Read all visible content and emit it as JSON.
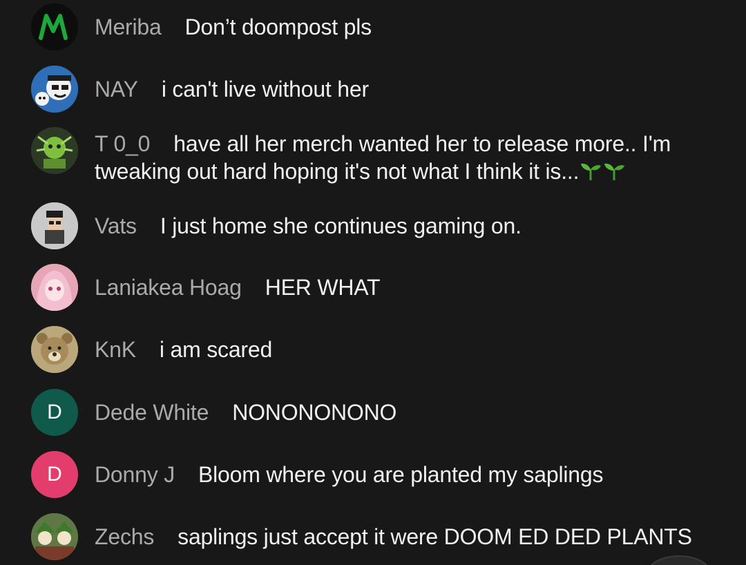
{
  "messages": [
    {
      "author": "Meriba",
      "text": "Don’t doompost pls",
      "avatar": {
        "kind": "image",
        "icon": "green-m-logo",
        "bg": "#0d0d0d",
        "accent": "#1fa83a"
      }
    },
    {
      "author": "NAY",
      "text": "i can't live without her",
      "avatar": {
        "kind": "image",
        "icon": "cartoon-face",
        "bg": "#2f6fb7"
      }
    },
    {
      "author": "T 0_0",
      "text": "have all her merch wanted her to release more.. I'm tweaking out hard hoping it's not what I think it is...",
      "avatar": {
        "kind": "image",
        "icon": "green-creature",
        "bg": "#2c3a25"
      },
      "emoji": [
        "sprout",
        "sprout"
      ]
    },
    {
      "author": "Vats",
      "text": "I just home she continues gaming on.",
      "avatar": {
        "kind": "image",
        "icon": "pixel-character",
        "bg": "#c9c9c9"
      }
    },
    {
      "author": "Laniakea Hoag",
      "text": "HER WHAT",
      "avatar": {
        "kind": "image",
        "icon": "anime-girl-pink",
        "bg": "#e7a6b6"
      }
    },
    {
      "author": "KnK",
      "text": "i am scared",
      "avatar": {
        "kind": "image",
        "icon": "bear-face",
        "bg": "#bba77c"
      }
    },
    {
      "author": "Dede White",
      "text": "NONONONONO",
      "avatar": {
        "kind": "letter",
        "letter": "D",
        "bg": "#0f5a4b"
      }
    },
    {
      "author": "Donny J",
      "text": "Bloom where you are planted my saplings",
      "avatar": {
        "kind": "letter",
        "letter": "D",
        "bg": "#e33d6c"
      }
    },
    {
      "author": "Zechs",
      "text": "saplings just accept it were DOOM ED DED PLANTS",
      "avatar": {
        "kind": "image",
        "icon": "green-hat-characters",
        "bg": "#5f7745"
      }
    }
  ],
  "colors": {
    "background": "#181818",
    "author": "#aaaaaa",
    "message": "#f1f1f1"
  }
}
